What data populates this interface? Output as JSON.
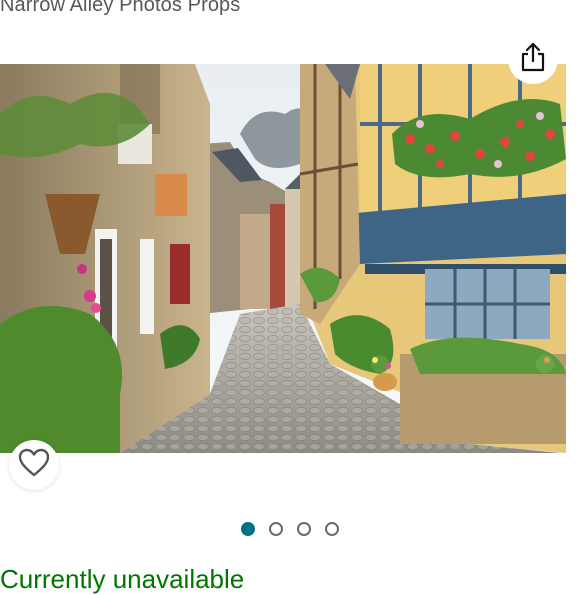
{
  "product": {
    "title": "Narrow Alley Photos Props",
    "availability": "Currently unavailable"
  },
  "gallery": {
    "image_count": 4,
    "active_index": 0
  },
  "icons": {
    "share": "share-icon",
    "wishlist": "heart-icon"
  },
  "colors": {
    "accent": "#007185",
    "availability": "#007600",
    "title": "#565959"
  }
}
